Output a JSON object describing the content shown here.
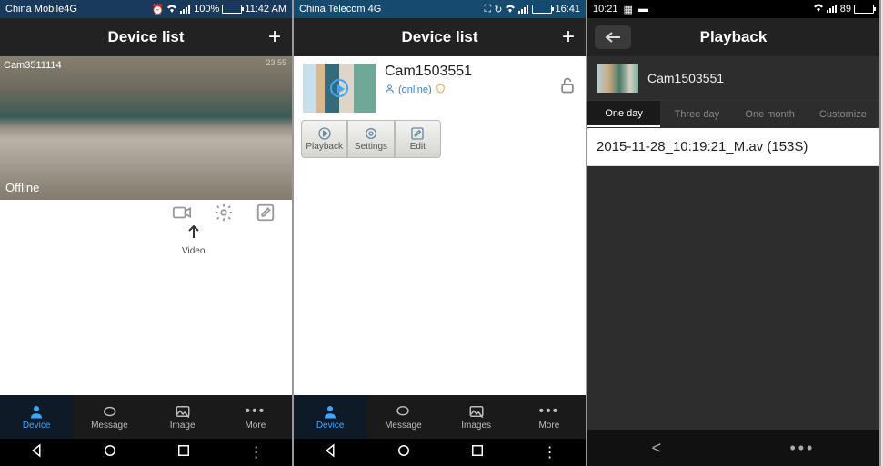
{
  "screen1": {
    "status": {
      "carrier": "China Mobile4G",
      "battery_pct": "100%",
      "time": "11:42 AM"
    },
    "header": {
      "title": "Device list"
    },
    "camera": {
      "label": "Cam3511114",
      "timestamp": "23 55",
      "status": "Offline"
    },
    "video_hint": "Video",
    "tabs": {
      "device": "Device",
      "message": "Message",
      "image": "Image",
      "more": "More"
    }
  },
  "screen2": {
    "status": {
      "carrier": "China Telecom 4G",
      "time": "16:41"
    },
    "header": {
      "title": "Device list"
    },
    "camera": {
      "name": "Cam1503551",
      "status": "(online)"
    },
    "actions": {
      "playback": "Playback",
      "settings": "Settings",
      "edit": "Edit"
    },
    "tabs": {
      "device": "Device",
      "message": "Message",
      "images": "Images",
      "more": "More"
    }
  },
  "screen3": {
    "status": {
      "time": "10:21",
      "battery": "89"
    },
    "header": {
      "title": "Playback"
    },
    "camera_name": "Cam1503551",
    "tabs": {
      "one_day": "One day",
      "three_day": "Three day",
      "one_month": "One month",
      "custom": "Customize"
    },
    "file": "2015-11-28_10:19:21_M.av (153S)"
  }
}
